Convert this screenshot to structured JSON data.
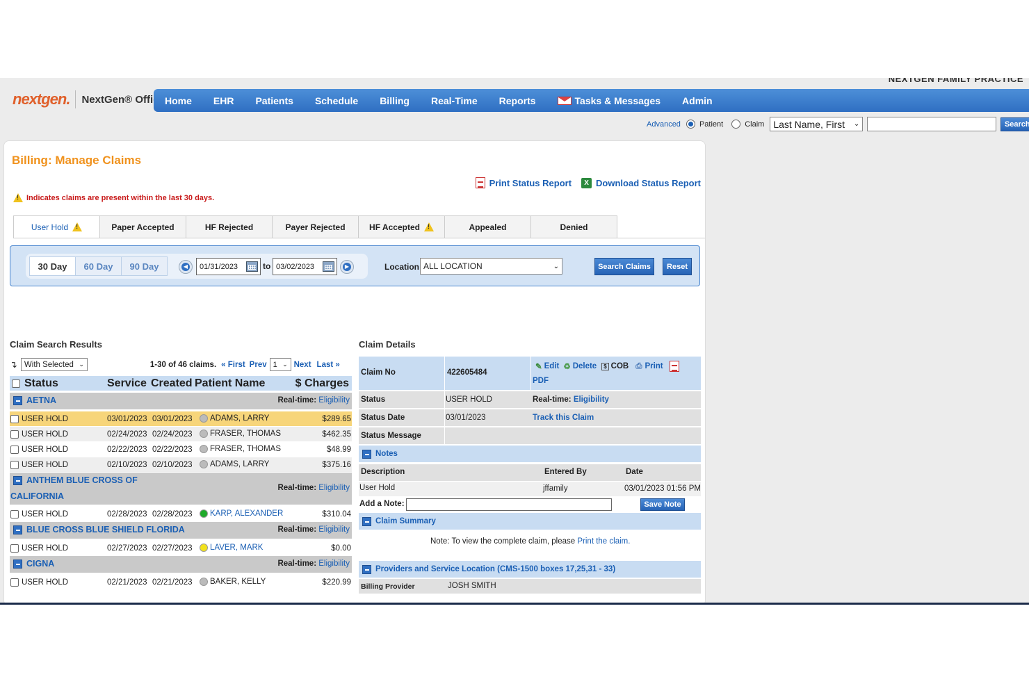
{
  "practice_name": "NEXTGEN FAMILY PRACTICE",
  "brand": {
    "logo_text": "nextgen.",
    "product": "NextGen® Office"
  },
  "nav": [
    "Home",
    "EHR",
    "Patients",
    "Schedule",
    "Billing",
    "Real-Time",
    "Reports",
    "Tasks & Messages",
    "Admin"
  ],
  "search": {
    "advanced": "Advanced",
    "patient": "Patient",
    "claim": "Claim",
    "select_value": "Last Name, First",
    "button": "Search"
  },
  "page": {
    "title": "Billing: Manage Claims",
    "print_report": "Print Status Report",
    "download_report": "Download Status Report",
    "warning": "Indicates claims are present within the last 30 days."
  },
  "tabs": [
    "User Hold",
    "Paper Accepted",
    "HF Rejected",
    "Payer Rejected",
    "HF Accepted",
    "Appealed",
    "Denied"
  ],
  "filter": {
    "ranges": [
      "30 Day",
      "60 Day",
      "90 Day"
    ],
    "start_date": "01/31/2023",
    "to": "to",
    "end_date": "03/02/2023",
    "location_label": "Location",
    "location_value": "ALL LOCATION",
    "search_button": "Search Claims",
    "reset_button": "Reset"
  },
  "results": {
    "title": "Claim Search Results",
    "with_selected": "With Selected",
    "count": "1-30 of 46 claims.",
    "first": "« First",
    "prev": "Prev",
    "page": "1",
    "next": "Next",
    "last": "Last »",
    "columns": [
      "Status",
      "Service",
      "Created",
      "Patient Name",
      "$ Charges"
    ],
    "rows": [
      {
        "kind": "group",
        "name": "AETNA",
        "realtime": "Real-time:",
        "elig": "Eligibility"
      },
      {
        "kind": "claim",
        "status": "USER HOLD",
        "service": "03/01/2023",
        "created": "03/01/2023",
        "patient": "ADAMS, LARRY",
        "charges": "$289.65",
        "dot": "#bbbbbb",
        "highlight": true,
        "bg": "#fff"
      },
      {
        "kind": "claim",
        "status": "USER HOLD",
        "service": "02/24/2023",
        "created": "02/24/2023",
        "patient": "FRASER, THOMAS",
        "charges": "$462.35",
        "dot": "#bbbbbb",
        "bg": "#eeeeee"
      },
      {
        "kind": "claim",
        "status": "USER HOLD",
        "service": "02/22/2023",
        "created": "02/22/2023",
        "patient": "FRASER, THOMAS",
        "charges": "$48.99",
        "dot": "#bbbbbb",
        "bg": "#ffffff"
      },
      {
        "kind": "claim",
        "status": "USER HOLD",
        "service": "02/10/2023",
        "created": "02/10/2023",
        "patient": "ADAMS, LARRY",
        "charges": "$375.16",
        "dot": "#bbbbbb",
        "bg": "#eeeeee"
      },
      {
        "kind": "group2",
        "name1": "ANTHEM BLUE CROSS OF",
        "name2": "CALIFORNIA",
        "realtime": "Real-time:",
        "elig": "Eligibility"
      },
      {
        "kind": "claim",
        "status": "USER HOLD",
        "service": "02/28/2023",
        "created": "02/28/2023",
        "patient": "KARP, ALEXANDER",
        "charges": "$310.04",
        "dot": "#1faa2a",
        "link": true,
        "bg": "#fff"
      },
      {
        "kind": "group",
        "name": "BLUE CROSS BLUE SHIELD FLORIDA",
        "realtime": "Real-time:",
        "elig": "Eligibility"
      },
      {
        "kind": "claim",
        "status": "USER HOLD",
        "service": "02/27/2023",
        "created": "02/27/2023",
        "patient": "LAVER, MARK",
        "charges": "$0.00",
        "dot": "#f2e21d",
        "link": true,
        "bg": "#fff"
      },
      {
        "kind": "group",
        "name": "CIGNA",
        "realtime": "Real-time:",
        "elig": "Eligibility"
      },
      {
        "kind": "claim",
        "status": "USER HOLD",
        "service": "02/21/2023",
        "created": "02/21/2023",
        "patient": "BAKER, KELLY",
        "charges": "$220.99",
        "dot": "#bbbbbb",
        "bg": "#fff"
      }
    ]
  },
  "details": {
    "title": "Claim Details",
    "claim_no_label": "Claim No",
    "claim_no": "422605484",
    "actions": [
      "Edit",
      "Delete",
      "COB",
      "Print",
      "PDF"
    ],
    "fields": [
      {
        "label": "Status",
        "value": "USER HOLD",
        "extra_label": "Real-time:",
        "extra_link": "Eligibility"
      },
      {
        "label": "Status Date",
        "value": "03/01/2023",
        "extra_label": "",
        "extra_link": "Track this Claim"
      },
      {
        "label": "Status Message",
        "value": "",
        "extra_label": "",
        "extra_link": ""
      }
    ],
    "notes": {
      "title": "Notes",
      "columns": [
        "Description",
        "Entered By",
        "Date"
      ],
      "row": {
        "description": "User Hold",
        "entered_by": "jffamily",
        "date": "03/01/2023 01:56 PM"
      },
      "add_label": "Add a Note:",
      "save": "Save Note"
    },
    "summary": {
      "title": "Claim Summary",
      "note": "Note:  To view the complete claim, please",
      "link": "Print the claim."
    },
    "providers": {
      "title": "Providers and Service Location  (CMS-1500 boxes 17,25,31 - 33)",
      "billing_label": "Billing Provider",
      "billing_value": "JOSH SMITH"
    }
  }
}
